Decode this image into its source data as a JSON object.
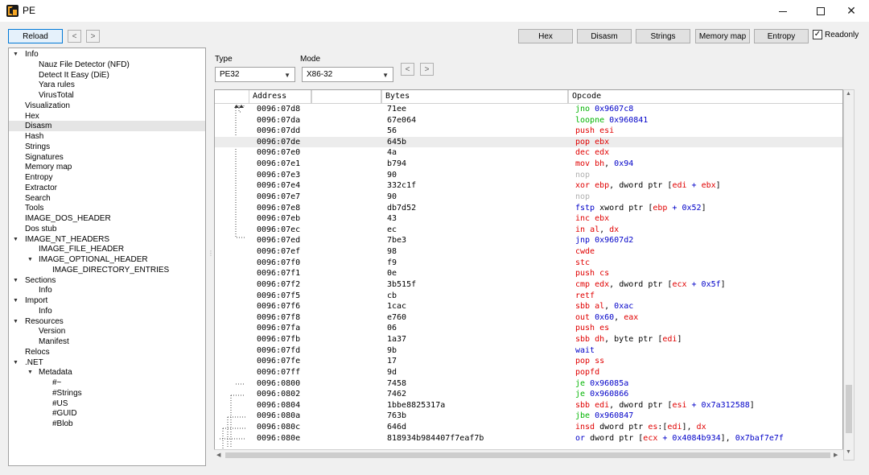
{
  "window": {
    "title": "PE"
  },
  "toolbar": {
    "reload": "Reload",
    "back": "<",
    "forward": ">",
    "hex": "Hex",
    "disasm": "Disasm",
    "strings": "Strings",
    "memory_map": "Memory map",
    "entropy": "Entropy",
    "readonly": "Readonly",
    "readonly_check": "✓"
  },
  "tree": [
    {
      "label": "Info",
      "level": 0,
      "arrow": "▼"
    },
    {
      "label": "Nauz File Detector (NFD)",
      "level": 2
    },
    {
      "label": "Detect It Easy (DiE)",
      "level": 2
    },
    {
      "label": "Yara rules",
      "level": 2
    },
    {
      "label": "VirusTotal",
      "level": 2
    },
    {
      "label": "Visualization",
      "level": 1
    },
    {
      "label": "Hex",
      "level": 1
    },
    {
      "label": "Disasm",
      "level": 1,
      "selected": true
    },
    {
      "label": "Hash",
      "level": 1
    },
    {
      "label": "Strings",
      "level": 1
    },
    {
      "label": "Signatures",
      "level": 1
    },
    {
      "label": "Memory map",
      "level": 1
    },
    {
      "label": "Entropy",
      "level": 1
    },
    {
      "label": "Extractor",
      "level": 1
    },
    {
      "label": "Search",
      "level": 1
    },
    {
      "label": "Tools",
      "level": 1
    },
    {
      "label": "IMAGE_DOS_HEADER",
      "level": 1
    },
    {
      "label": "Dos stub",
      "level": 1
    },
    {
      "label": "IMAGE_NT_HEADERS",
      "level": 0,
      "arrow": "▼"
    },
    {
      "label": "IMAGE_FILE_HEADER",
      "level": 2
    },
    {
      "label": "IMAGE_OPTIONAL_HEADER",
      "level": 1.6,
      "arrow": "▼"
    },
    {
      "label": "IMAGE_DIRECTORY_ENTRIES",
      "level": 3
    },
    {
      "label": "Sections",
      "level": 0,
      "arrow": "▼"
    },
    {
      "label": "Info",
      "level": 2
    },
    {
      "label": "Import",
      "level": 0,
      "arrow": "▼"
    },
    {
      "label": "Info",
      "level": 2
    },
    {
      "label": "Resources",
      "level": 0,
      "arrow": "▼"
    },
    {
      "label": "Version",
      "level": 2
    },
    {
      "label": "Manifest",
      "level": 2
    },
    {
      "label": "Relocs",
      "level": 1
    },
    {
      "label": ".NET",
      "level": 0,
      "arrow": "▼"
    },
    {
      "label": "Metadata",
      "level": 1.6,
      "arrow": "▼"
    },
    {
      "label": "#~",
      "level": 3
    },
    {
      "label": "#Strings",
      "level": 3
    },
    {
      "label": "#US",
      "level": 3
    },
    {
      "label": "#GUID",
      "level": 3
    },
    {
      "label": "#Blob",
      "level": 3
    }
  ],
  "selectors": {
    "type_label": "Type",
    "type_value": "PE32",
    "mode_label": "Mode",
    "mode_value": "X86-32",
    "back": "<",
    "forward": ">"
  },
  "table": {
    "columns": [
      "Address",
      "",
      "Bytes",
      "Opcode"
    ],
    "rows": [
      {
        "addr": "0096:07d8",
        "bytes": "71ee",
        "op": [
          [
            "jno",
            "mj"
          ],
          [
            " 0x9607c8",
            "num"
          ]
        ]
      },
      {
        "addr": "0096:07da",
        "bytes": "67e064",
        "op": [
          [
            "loopne",
            "mj"
          ],
          [
            " 0x960841",
            "num"
          ]
        ]
      },
      {
        "addr": "0096:07dd",
        "bytes": "56",
        "op": [
          [
            "push",
            "mr"
          ],
          [
            " esi",
            "reg"
          ]
        ]
      },
      {
        "addr": "0096:07de",
        "bytes": "645b",
        "op": [
          [
            "pop",
            "mr"
          ],
          [
            " ebx",
            "reg"
          ]
        ],
        "selected": true
      },
      {
        "addr": "0096:07e0",
        "bytes": "4a",
        "op": [
          [
            "dec",
            "mr"
          ],
          [
            " edx",
            "reg"
          ]
        ]
      },
      {
        "addr": "0096:07e1",
        "bytes": "b794",
        "op": [
          [
            "mov",
            "mr"
          ],
          [
            " bh",
            "reg"
          ],
          [
            ", ",
            "plain"
          ],
          [
            "0x94",
            "num"
          ]
        ]
      },
      {
        "addr": "0096:07e3",
        "bytes": "90",
        "op": [
          [
            "nop",
            "mg"
          ]
        ]
      },
      {
        "addr": "0096:07e4",
        "bytes": "332c1f",
        "op": [
          [
            "xor",
            "mr"
          ],
          [
            " ebp",
            "reg"
          ],
          [
            ", dword ptr [",
            "plain"
          ],
          [
            "edi",
            "reg"
          ],
          [
            " + ",
            "num"
          ],
          [
            "ebx",
            "reg"
          ],
          [
            "]",
            "plain"
          ]
        ]
      },
      {
        "addr": "0096:07e7",
        "bytes": "90",
        "op": [
          [
            "nop",
            "mg"
          ]
        ]
      },
      {
        "addr": "0096:07e8",
        "bytes": "db7d52",
        "op": [
          [
            "fstp",
            "mb"
          ],
          [
            " xword ptr [",
            "plain"
          ],
          [
            "ebp",
            "reg"
          ],
          [
            " + 0x52",
            "num"
          ],
          [
            "]",
            "plain"
          ]
        ]
      },
      {
        "addr": "0096:07eb",
        "bytes": "43",
        "op": [
          [
            "inc",
            "mr"
          ],
          [
            " ebx",
            "reg"
          ]
        ]
      },
      {
        "addr": "0096:07ec",
        "bytes": "ec",
        "op": [
          [
            "in",
            "mr"
          ],
          [
            " al",
            "reg"
          ],
          [
            ", ",
            "plain"
          ],
          [
            "dx",
            "reg"
          ]
        ]
      },
      {
        "addr": "0096:07ed",
        "bytes": "7be3",
        "op": [
          [
            "jnp",
            "mb"
          ],
          [
            " 0x9607d2",
            "num"
          ]
        ]
      },
      {
        "addr": "0096:07ef",
        "bytes": "98",
        "op": [
          [
            "cwde",
            "mr"
          ]
        ]
      },
      {
        "addr": "0096:07f0",
        "bytes": "f9",
        "op": [
          [
            "stc",
            "mr"
          ]
        ]
      },
      {
        "addr": "0096:07f1",
        "bytes": "0e",
        "op": [
          [
            "push",
            "mr"
          ],
          [
            " cs",
            "reg"
          ]
        ]
      },
      {
        "addr": "0096:07f2",
        "bytes": "3b515f",
        "op": [
          [
            "cmp",
            "mr"
          ],
          [
            " edx",
            "reg"
          ],
          [
            ", dword ptr [",
            "plain"
          ],
          [
            "ecx",
            "reg"
          ],
          [
            " + 0x5f",
            "num"
          ],
          [
            "]",
            "plain"
          ]
        ]
      },
      {
        "addr": "0096:07f5",
        "bytes": "cb",
        "op": [
          [
            "retf",
            "mr"
          ]
        ]
      },
      {
        "addr": "0096:07f6",
        "bytes": "1cac",
        "op": [
          [
            "sbb",
            "mr"
          ],
          [
            " al",
            "reg"
          ],
          [
            ", ",
            "plain"
          ],
          [
            "0xac",
            "num"
          ]
        ]
      },
      {
        "addr": "0096:07f8",
        "bytes": "e760",
        "op": [
          [
            "out",
            "mr"
          ],
          [
            " 0x60",
            "num"
          ],
          [
            ", ",
            "plain"
          ],
          [
            "eax",
            "reg"
          ]
        ]
      },
      {
        "addr": "0096:07fa",
        "bytes": "06",
        "op": [
          [
            "push",
            "mr"
          ],
          [
            " es",
            "reg"
          ]
        ]
      },
      {
        "addr": "0096:07fb",
        "bytes": "1a37",
        "op": [
          [
            "sbb",
            "mr"
          ],
          [
            " dh",
            "reg"
          ],
          [
            ", byte ptr [",
            "plain"
          ],
          [
            "edi",
            "reg"
          ],
          [
            "]",
            "plain"
          ]
        ]
      },
      {
        "addr": "0096:07fd",
        "bytes": "9b",
        "op": [
          [
            "wait",
            "mb"
          ]
        ]
      },
      {
        "addr": "0096:07fe",
        "bytes": "17",
        "op": [
          [
            "pop",
            "mr"
          ],
          [
            " ss",
            "reg"
          ]
        ]
      },
      {
        "addr": "0096:07ff",
        "bytes": "9d",
        "op": [
          [
            "popfd",
            "mr"
          ]
        ]
      },
      {
        "addr": "0096:0800",
        "bytes": "7458",
        "op": [
          [
            "je",
            "mj"
          ],
          [
            " 0x96085a",
            "num"
          ]
        ]
      },
      {
        "addr": "0096:0802",
        "bytes": "7462",
        "op": [
          [
            "je",
            "mj"
          ],
          [
            " 0x960866",
            "num"
          ]
        ]
      },
      {
        "addr": "0096:0804",
        "bytes": "1bbe8825317a",
        "op": [
          [
            "sbb",
            "mr"
          ],
          [
            " edi",
            "reg"
          ],
          [
            ", dword ptr [",
            "plain"
          ],
          [
            "esi",
            "reg"
          ],
          [
            " + 0x7a312588",
            "num"
          ],
          [
            "]",
            "plain"
          ]
        ]
      },
      {
        "addr": "0096:080a",
        "bytes": "763b",
        "op": [
          [
            "jbe",
            "mj"
          ],
          [
            " 0x960847",
            "num"
          ]
        ]
      },
      {
        "addr": "0096:080c",
        "bytes": "646d",
        "op": [
          [
            "insd",
            "mr"
          ],
          [
            " dword ptr ",
            "plain"
          ],
          [
            "es",
            "reg"
          ],
          [
            ":[",
            "plain"
          ],
          [
            "edi",
            "reg"
          ],
          [
            "], ",
            "plain"
          ],
          [
            "dx",
            "reg"
          ]
        ]
      },
      {
        "addr": "0096:080e",
        "bytes": "818934b984407f7eaf7b",
        "op": [
          [
            "or",
            "mb"
          ],
          [
            " dword ptr [",
            "plain"
          ],
          [
            "ecx",
            "reg"
          ],
          [
            " + 0x4084b934",
            "num"
          ],
          [
            "], ",
            "plain"
          ],
          [
            "0x7baf7e7f",
            "num"
          ]
        ]
      }
    ]
  },
  "colors": {
    "mnemonic_red": "#e00000",
    "mnemonic_green": "#00b400",
    "mnemonic_blue": "#0000c8",
    "mnemonic_gray": "#b0b0b0",
    "number_blue": "#0000c8",
    "accent": "#0078d7"
  }
}
